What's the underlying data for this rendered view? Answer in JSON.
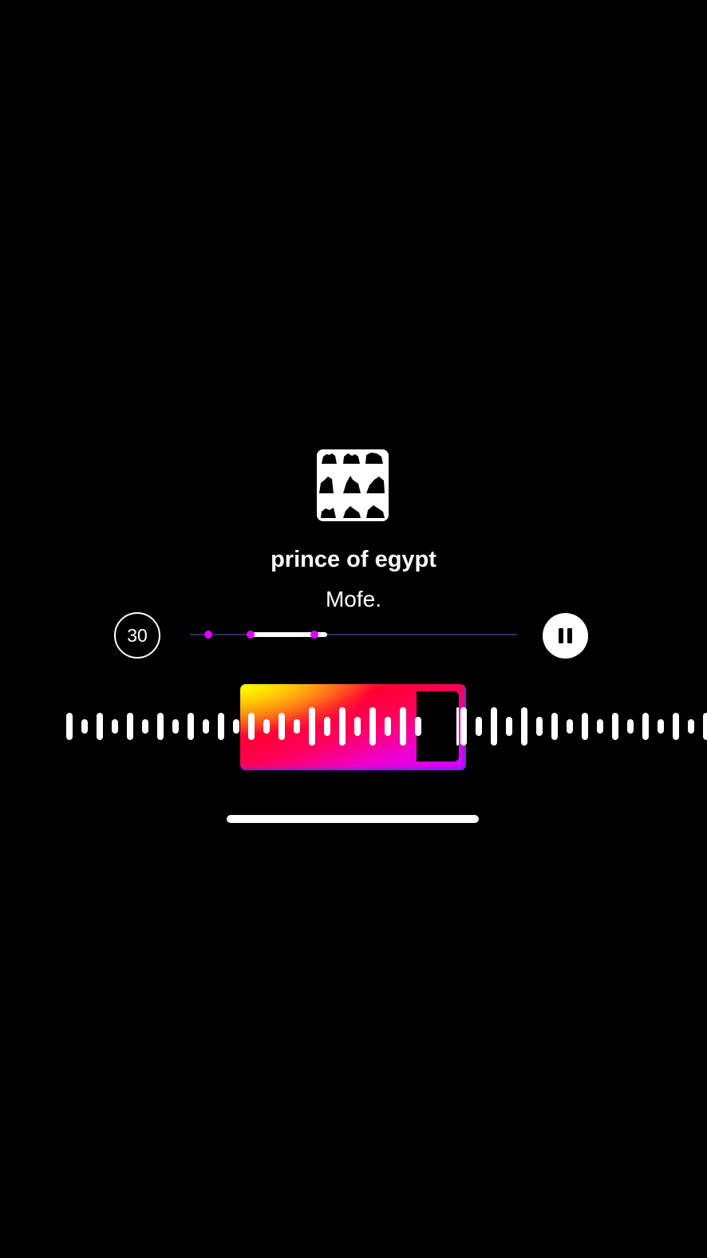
{
  "now_playing": {
    "title": "prince of egypt",
    "artist": "Mofe."
  },
  "controls": {
    "duration_label": "30",
    "pause_icon": "pause-icon"
  },
  "scrubber": {
    "selection_start_fraction": 0.19,
    "selection_end_fraction": 0.42,
    "markers_fraction": [
      0.055,
      0.185,
      0.38
    ]
  },
  "waveform": {
    "selected_start_fraction": 0.34,
    "selected_end_fraction": 0.66,
    "playhead_fraction": 0.62
  },
  "colors": {
    "background": "#000000",
    "accent_magenta": "#e100ff",
    "selection_gradient": [
      "#ffff00",
      "#ff0030",
      "#e100ff"
    ],
    "track_line": "#2b2f66"
  },
  "icons": {
    "artwork": "album-artwork",
    "pause": "pause-icon"
  }
}
